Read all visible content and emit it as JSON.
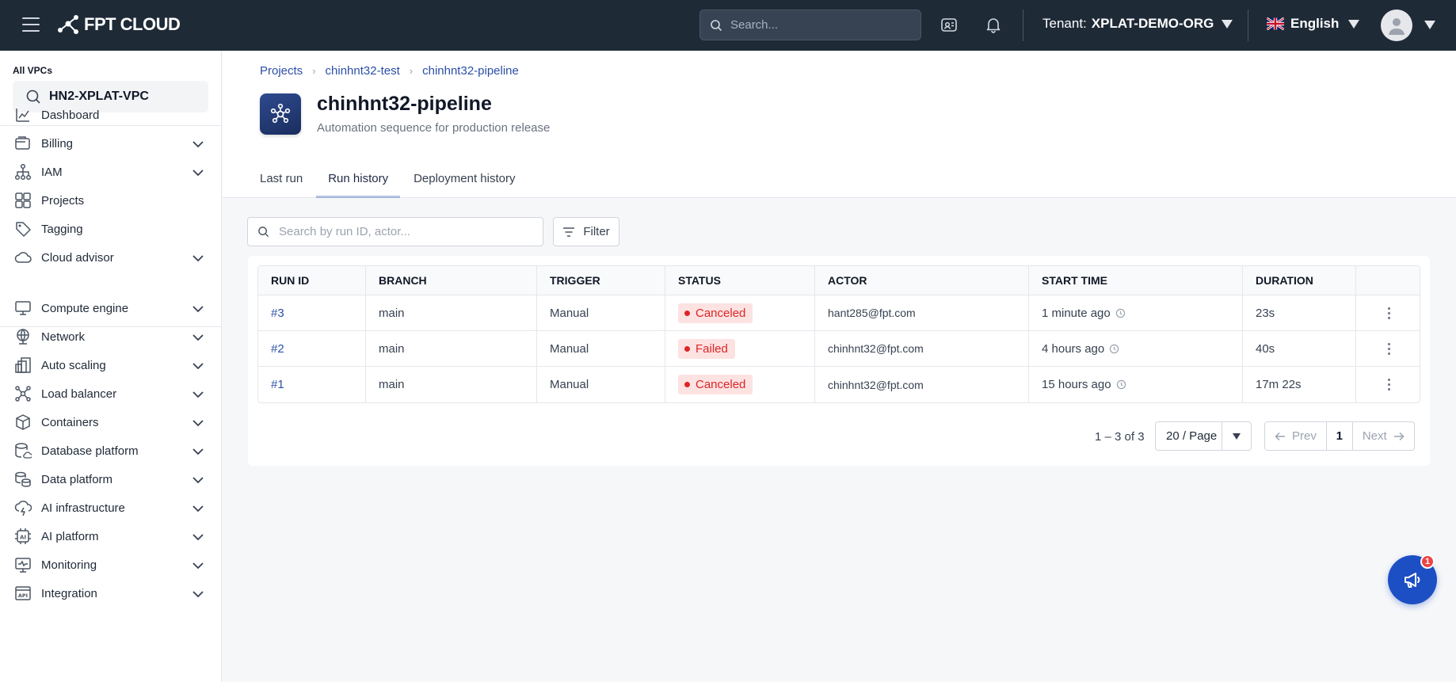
{
  "header": {
    "logo_text": "FPT CLOUD",
    "search_placeholder": "Search...",
    "tenant_label": "Tenant:",
    "tenant_value": "XPLAT-DEMO-ORG",
    "language": "English"
  },
  "sidebar": {
    "vpc_label": "All VPCs",
    "vpc_value": "HN2-XPLAT-VPC",
    "items": [
      {
        "label": "Dashboard",
        "icon": "dashboard-icon",
        "expandable": false
      },
      {
        "label": "Billing",
        "icon": "wallet-icon",
        "expandable": true
      },
      {
        "label": "IAM",
        "icon": "hierarchy-icon",
        "expandable": true
      },
      {
        "label": "Projects",
        "icon": "grid-icon",
        "expandable": false
      },
      {
        "label": "Tagging",
        "icon": "tag-icon",
        "expandable": false
      },
      {
        "label": "Cloud advisor",
        "icon": "cloud-icon",
        "expandable": true
      },
      {
        "label": "Compute engine",
        "icon": "monitor-icon",
        "expandable": true
      },
      {
        "label": "Network",
        "icon": "globe-icon",
        "expandable": true
      },
      {
        "label": "Auto scaling",
        "icon": "scale-icon",
        "expandable": true
      },
      {
        "label": "Load balancer",
        "icon": "nodes-icon",
        "expandable": true
      },
      {
        "label": "Containers",
        "icon": "box-icon",
        "expandable": true
      },
      {
        "label": "Database platform",
        "icon": "database-icon",
        "expandable": true
      },
      {
        "label": "Data platform",
        "icon": "coins-icon",
        "expandable": true
      },
      {
        "label": "AI infrastructure",
        "icon": "cloud-bolt-icon",
        "expandable": true
      },
      {
        "label": "AI platform",
        "icon": "ai-chip-icon",
        "expandable": true
      },
      {
        "label": "Monitoring",
        "icon": "pulse-icon",
        "expandable": true
      },
      {
        "label": "Integration",
        "icon": "api-icon",
        "expandable": true
      }
    ]
  },
  "breadcrumb": [
    "Projects",
    "chinhnt32-test",
    "chinhnt32-pipeline"
  ],
  "page": {
    "title": "chinhnt32-pipeline",
    "subtitle": "Automation sequence for production release"
  },
  "tabs": [
    {
      "label": "Last run",
      "active": false
    },
    {
      "label": "Run history",
      "active": true
    },
    {
      "label": "Deployment history",
      "active": false
    }
  ],
  "toolbar": {
    "search_placeholder": "Search by run ID, actor...",
    "filter_label": "Filter"
  },
  "table": {
    "columns": [
      "RUN ID",
      "BRANCH",
      "TRIGGER",
      "STATUS",
      "ACTOR",
      "START TIME",
      "DURATION"
    ],
    "rows": [
      {
        "run_id": "#3",
        "branch": "main",
        "trigger": "Manual",
        "status": "Canceled",
        "actor": "hant285@fpt.com",
        "start_time": "1 minute ago",
        "duration": "23s"
      },
      {
        "run_id": "#2",
        "branch": "main",
        "trigger": "Manual",
        "status": "Failed",
        "actor": "chinhnt32@fpt.com",
        "start_time": "4 hours ago",
        "duration": "40s"
      },
      {
        "run_id": "#1",
        "branch": "main",
        "trigger": "Manual",
        "status": "Canceled",
        "actor": "chinhnt32@fpt.com",
        "start_time": "15 hours ago",
        "duration": "17m 22s"
      }
    ]
  },
  "pagination": {
    "range_text": "1 – 3 of 3",
    "page_size": "20 / Page",
    "prev_label": "Prev",
    "current_page": "1",
    "next_label": "Next"
  },
  "fab": {
    "badge_count": "1"
  },
  "colors": {
    "topbar": "#1f2a37",
    "link": "#2b4fa8",
    "status_red": "#dc2626",
    "status_red_bg": "#fde2e2",
    "fab": "#1d4fc4"
  }
}
